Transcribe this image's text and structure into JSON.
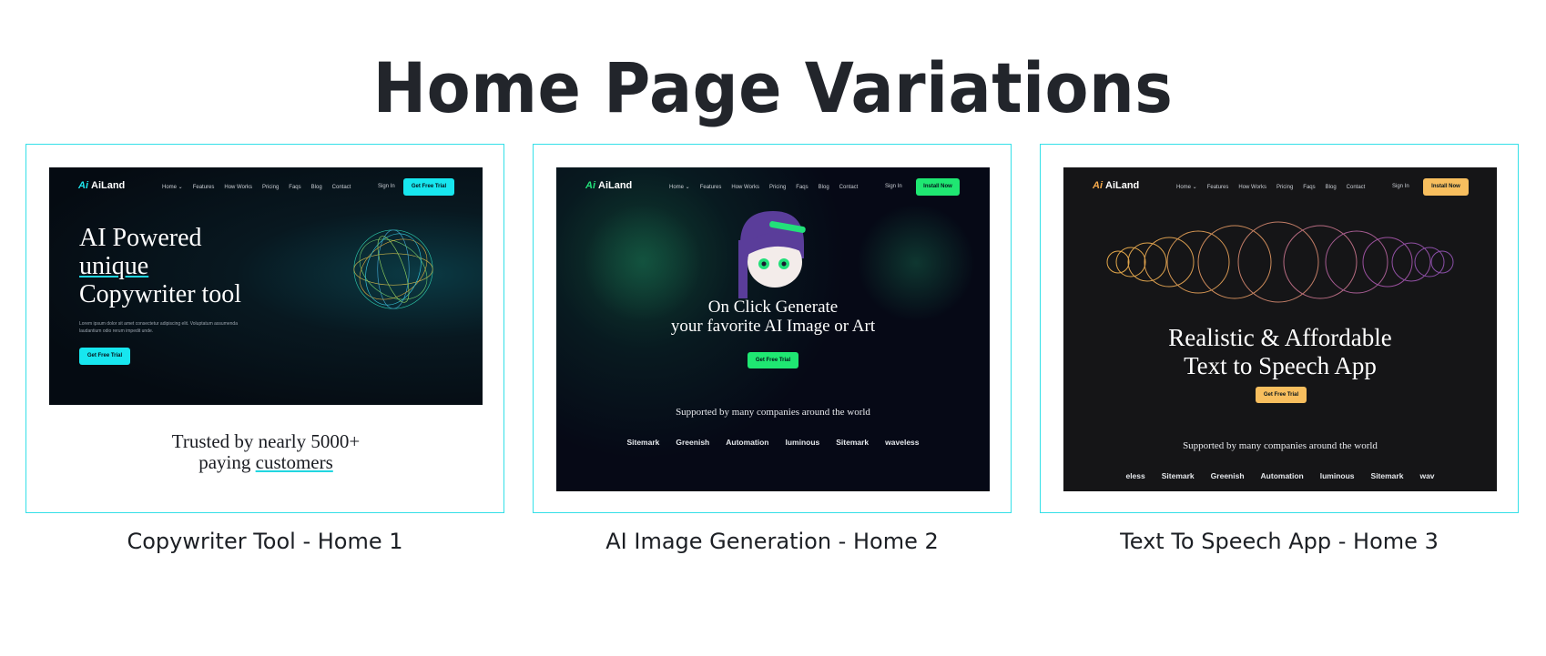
{
  "page": {
    "title": "Home Page Variations"
  },
  "cards": [
    {
      "caption": "Copywriter Tool - Home 1",
      "brand": "AiLand",
      "nav": [
        "Home ⌄",
        "Features",
        "How Works",
        "Pricing",
        "Faqs",
        "Blog",
        "Contact"
      ],
      "signin": "Sign In",
      "nav_button": "Get Free Trial",
      "hero_line1": "AI Powered",
      "hero_line2": "unique",
      "hero_line3": "Copywriter tool",
      "lorem": "Lorem ipsum dolor sit amet consectetur adipiscing elit. Voluptatum assumenda laudantium odio rerum impedit unde.",
      "cta": "Get Free Trial",
      "trusted_line1": "Trusted by nearly 5000+",
      "trusted_line2a": "paying",
      "trusted_line2b": "customers"
    },
    {
      "caption": "AI Image Generation - Home 2",
      "brand": "AiLand",
      "nav": [
        "Home ⌄",
        "Features",
        "How Works",
        "Pricing",
        "Faqs",
        "Blog",
        "Contact"
      ],
      "signin": "Sign In",
      "nav_button": "Install Now",
      "hero_line1": "On Click Generate",
      "hero_line2": "your favorite AI Image or Art",
      "cta": "Get Free Trial",
      "supported": "Supported by many companies around the world",
      "logos": [
        "Sitemark",
        "Greenish",
        "Automation",
        "luminous",
        "Sitemark",
        "waveless"
      ]
    },
    {
      "caption": "Text To Speech App - Home 3",
      "brand": "AiLand",
      "nav": [
        "Home ⌄",
        "Features",
        "How Works",
        "Pricing",
        "Faqs",
        "Blog",
        "Contact"
      ],
      "signin": "Sign In",
      "nav_button": "Install Now",
      "hero_line1": "Realistic & Affordable",
      "hero_line2": "Text to Speech App",
      "cta": "Get Free Trial",
      "supported": "Supported by many companies around the world",
      "logos": [
        "eless",
        "Sitemark",
        "Greenish",
        "Automation",
        "luminous",
        "Sitemark",
        "wav"
      ]
    }
  ],
  "colors": {
    "accent_cyan": "#34e0e8",
    "green": "#1fe772",
    "gold": "#f7be5e"
  }
}
